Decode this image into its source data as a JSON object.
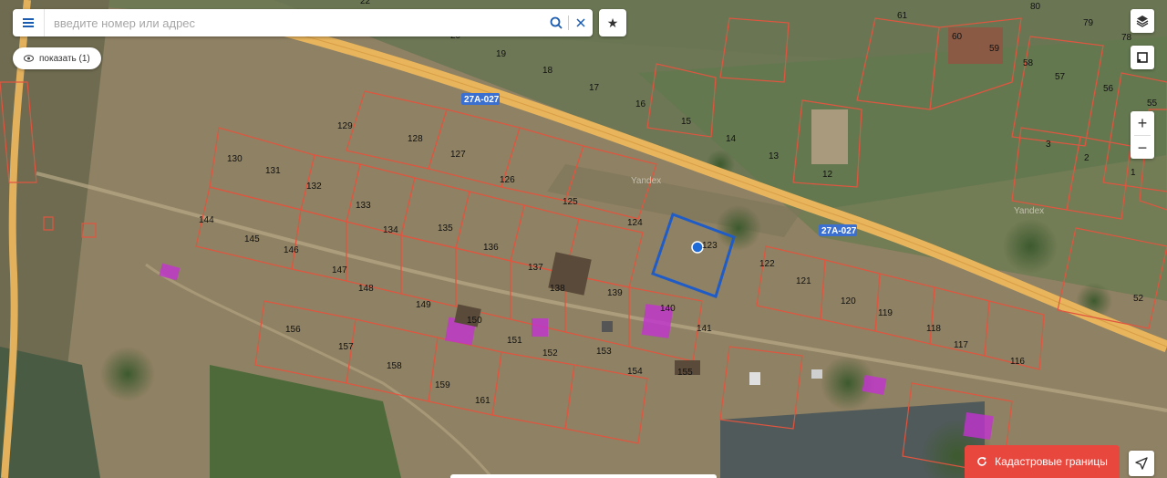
{
  "search": {
    "placeholder": "введите номер или адрес"
  },
  "show_button": {
    "label": "показать (1)"
  },
  "cadastral_button": {
    "label": "Кадастровые границы"
  },
  "road_labels": [
    "27A-027",
    "27A-027"
  ],
  "watermarks": [
    "Yandex",
    "Yandex"
  ],
  "parcels": [
    "80",
    "79",
    "78",
    "61",
    "60",
    "59",
    "58",
    "57",
    "56",
    "55",
    "22",
    "20",
    "19",
    "18",
    "17",
    "16",
    "15",
    "14",
    "13",
    "12",
    "129",
    "128",
    "127",
    "126",
    "125",
    "124",
    "123",
    "122",
    "121",
    "120",
    "119",
    "118",
    "117",
    "116",
    "130",
    "131",
    "132",
    "133",
    "134",
    "135",
    "136",
    "137",
    "138",
    "139",
    "140",
    "141",
    "144",
    "145",
    "146",
    "147",
    "148",
    "149",
    "150",
    "151",
    "152",
    "153",
    "154",
    "155",
    "156",
    "157",
    "158",
    "159",
    "161",
    "3",
    "2",
    "1",
    "52"
  ],
  "selected_parcel": "123",
  "colors": {
    "parcel_border": "#e0553f",
    "selected_border": "#1f5cc7",
    "road": "#e8b45c",
    "building": "#c233d0",
    "cadastral_button": "#e8473e"
  },
  "icons": [
    "menu-icon",
    "search-icon",
    "close-icon",
    "star-icon",
    "eye-icon",
    "layers-icon",
    "ruler-icon",
    "zoom-in-icon",
    "zoom-out-icon",
    "refresh-icon",
    "navigation-icon"
  ]
}
